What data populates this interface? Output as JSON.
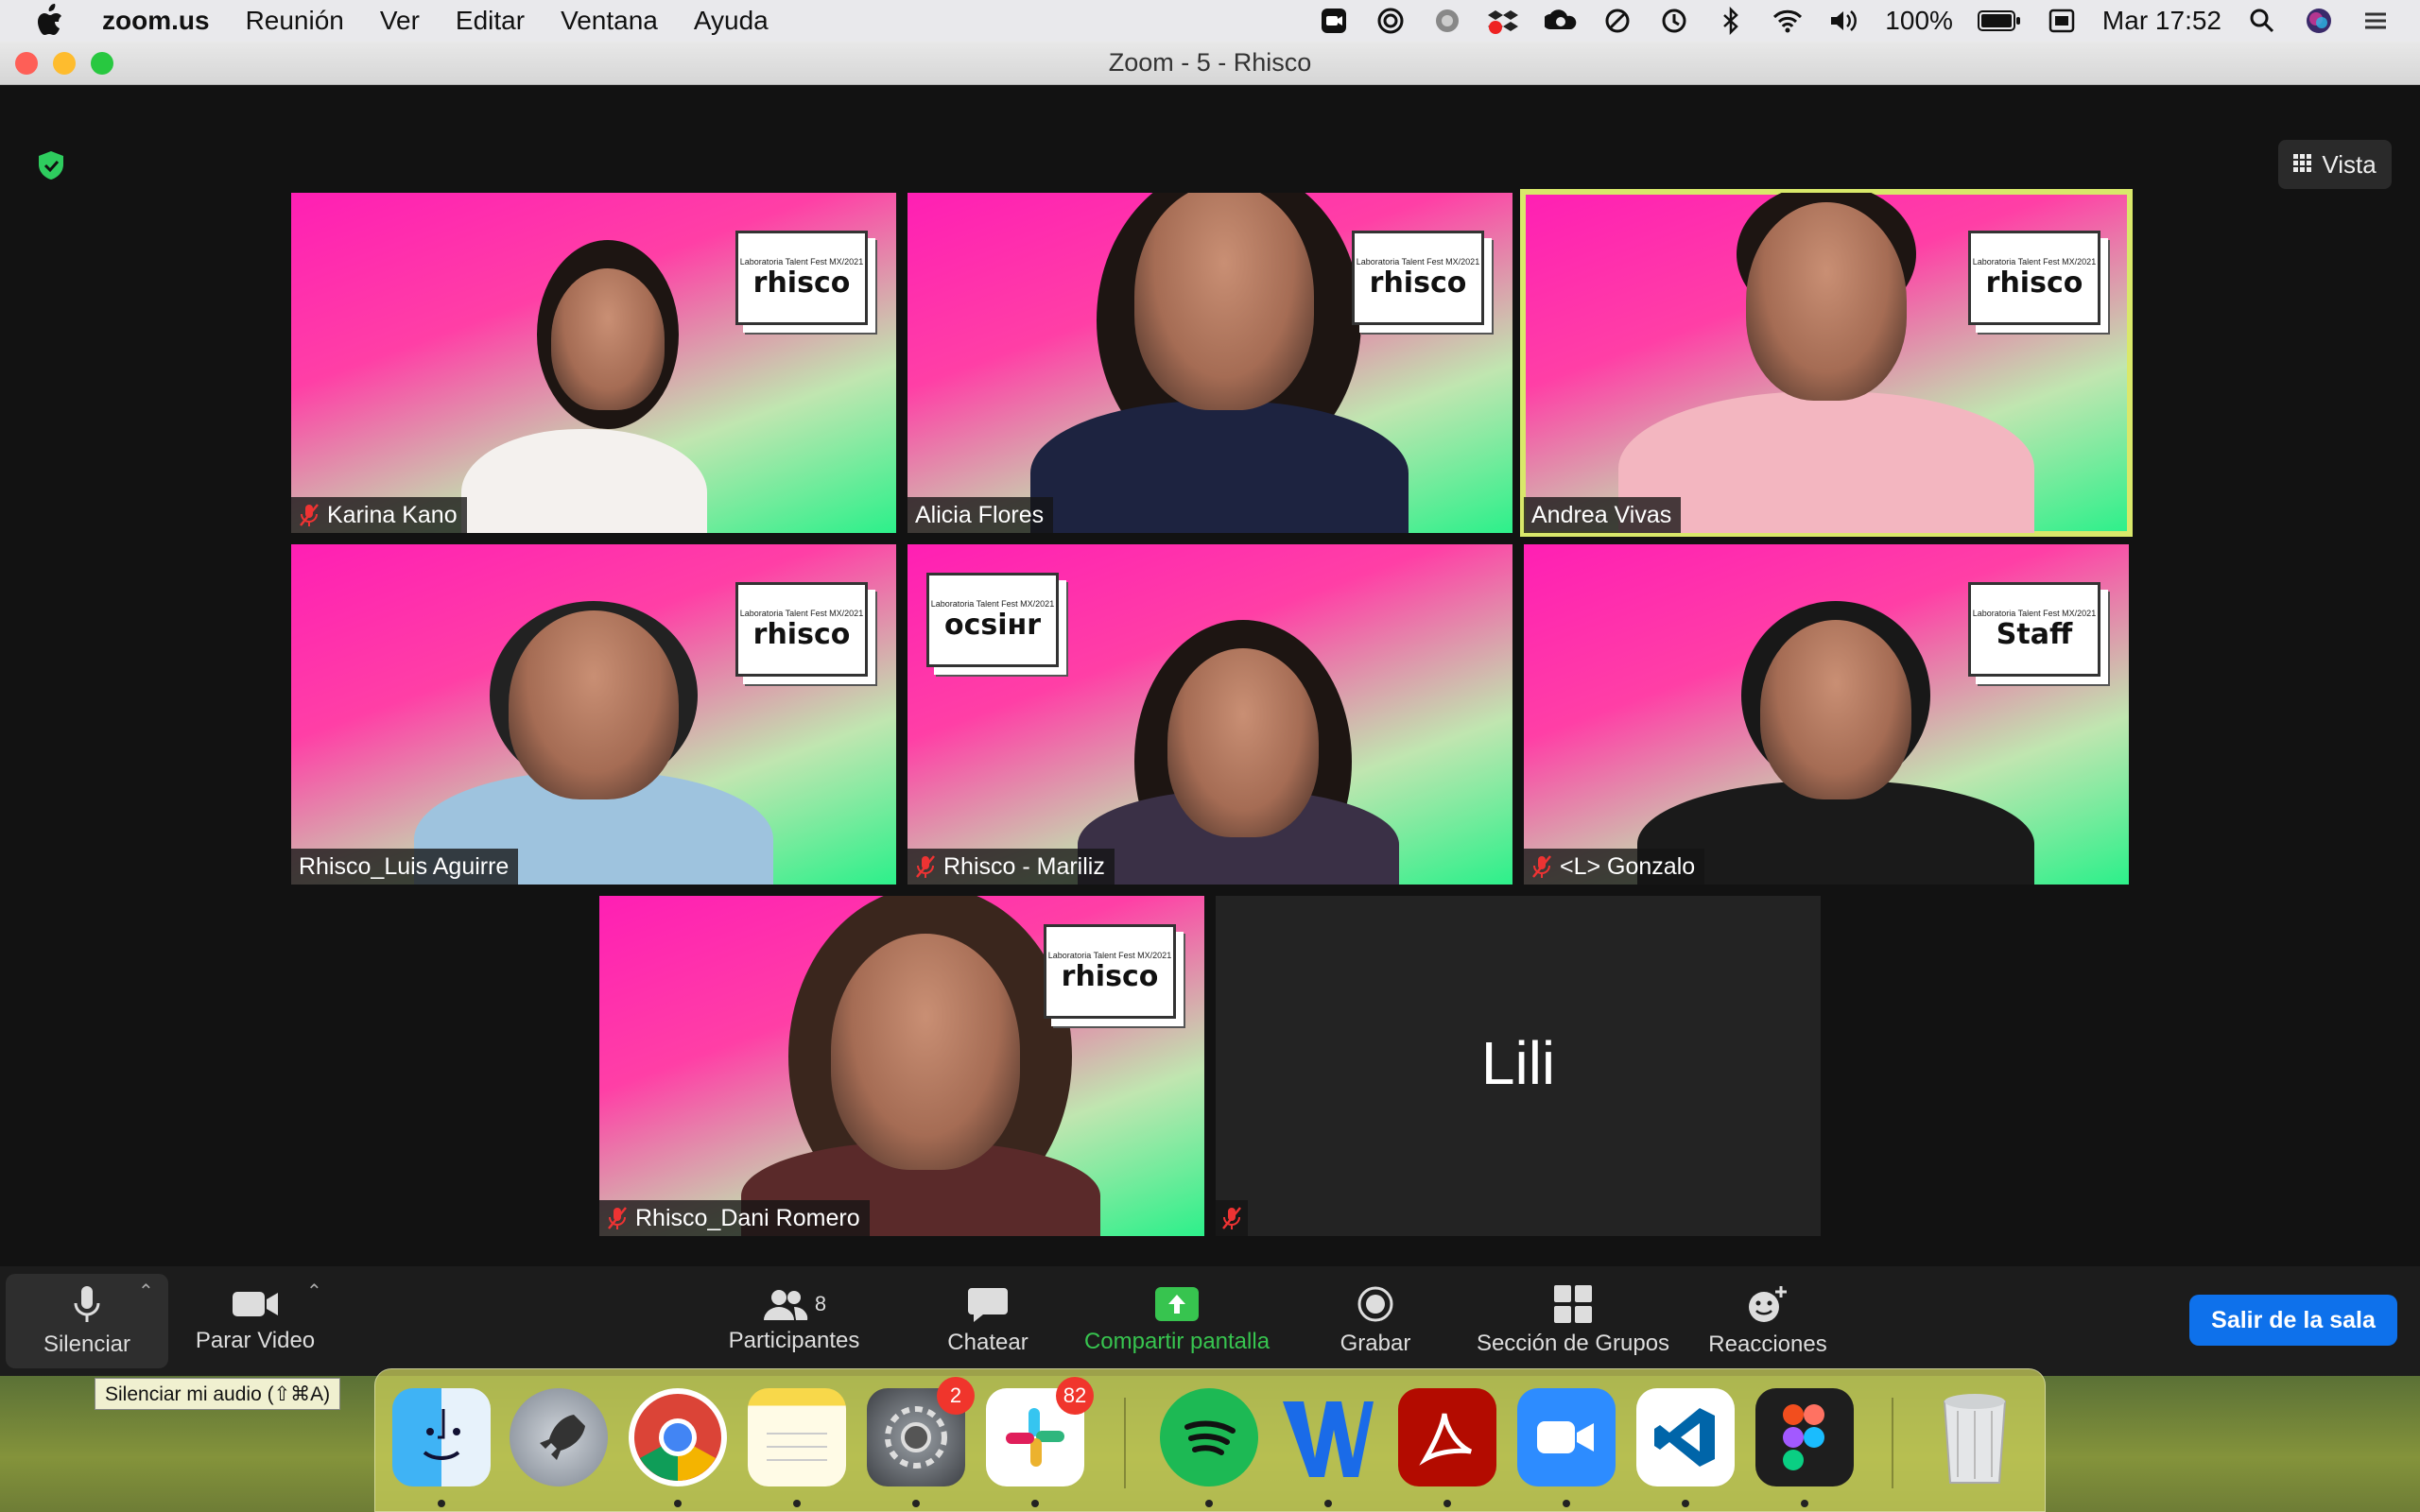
{
  "menubar": {
    "app": "zoom.us",
    "items": [
      "Reunión",
      "Ver",
      "Editar",
      "Ventana",
      "Ayuda"
    ],
    "battery": "100%",
    "clock": "Mar 17:52",
    "status_icons": [
      "zoom-icon",
      "target-icon",
      "cloud-icon",
      "dropbox-icon",
      "creative-cloud-icon",
      "sync-icon",
      "time-machine-icon",
      "bluetooth-icon",
      "wifi-icon",
      "volume-icon",
      "battery-icon",
      "keyboard-icon",
      "spotlight-icon",
      "siri-icon",
      "control-center-icon"
    ]
  },
  "window": {
    "title": "Zoom - 5 - Rhisco",
    "view_button": "Vista"
  },
  "participants": [
    {
      "name": "Karina Kano",
      "muted": true,
      "camera": true,
      "sign": "rhisco",
      "active": false
    },
    {
      "name": "Alicia Flores",
      "muted": false,
      "camera": true,
      "sign": "rhisco",
      "active": false
    },
    {
      "name": "Andrea Vivas",
      "muted": false,
      "camera": true,
      "sign": "rhisco",
      "active": true
    },
    {
      "name": "Rhisco_Luis Aguirre",
      "muted": false,
      "camera": true,
      "sign": "rhisco",
      "active": false
    },
    {
      "name": "Rhisco - Mariliz",
      "muted": true,
      "camera": true,
      "sign": "ocsiʜr",
      "active": false
    },
    {
      "name": "<L> Gonzalo",
      "muted": true,
      "camera": true,
      "sign": "Staff",
      "active": false
    },
    {
      "name": "Rhisco_Dani Romero",
      "muted": true,
      "camera": true,
      "sign": "rhisco",
      "active": false
    },
    {
      "name": "Lili",
      "muted": true,
      "camera": false,
      "sign": "",
      "active": false
    }
  ],
  "sign_small": "Laboratoria Talent Fest MX/2021",
  "toolbar": {
    "mute": "Silenciar",
    "video": "Parar Video",
    "participants": "Participantes",
    "participants_count": "8",
    "chat": "Chatear",
    "share": "Compartir pantalla",
    "record": "Grabar",
    "breakout": "Sección de Grupos",
    "reactions": "Reacciones",
    "leave": "Salir de la sala"
  },
  "tooltip": "Silenciar mi audio (⇧⌘A)",
  "dock": {
    "apps": [
      "Finder",
      "Launchpad",
      "Chrome",
      "Notes",
      "System Preferences",
      "Slack",
      "Spotify",
      "Word",
      "Acrobat",
      "Zoom",
      "VS Code",
      "Figma",
      "Trash"
    ],
    "badges": {
      "System Preferences": "2",
      "Slack": "82"
    }
  },
  "colors": {
    "accent": "#0e71eb",
    "speaking": "#d9e86a",
    "share_green": "#37c44f",
    "bg_pink": "#ff1fb4",
    "bg_green": "#2cf08a"
  }
}
